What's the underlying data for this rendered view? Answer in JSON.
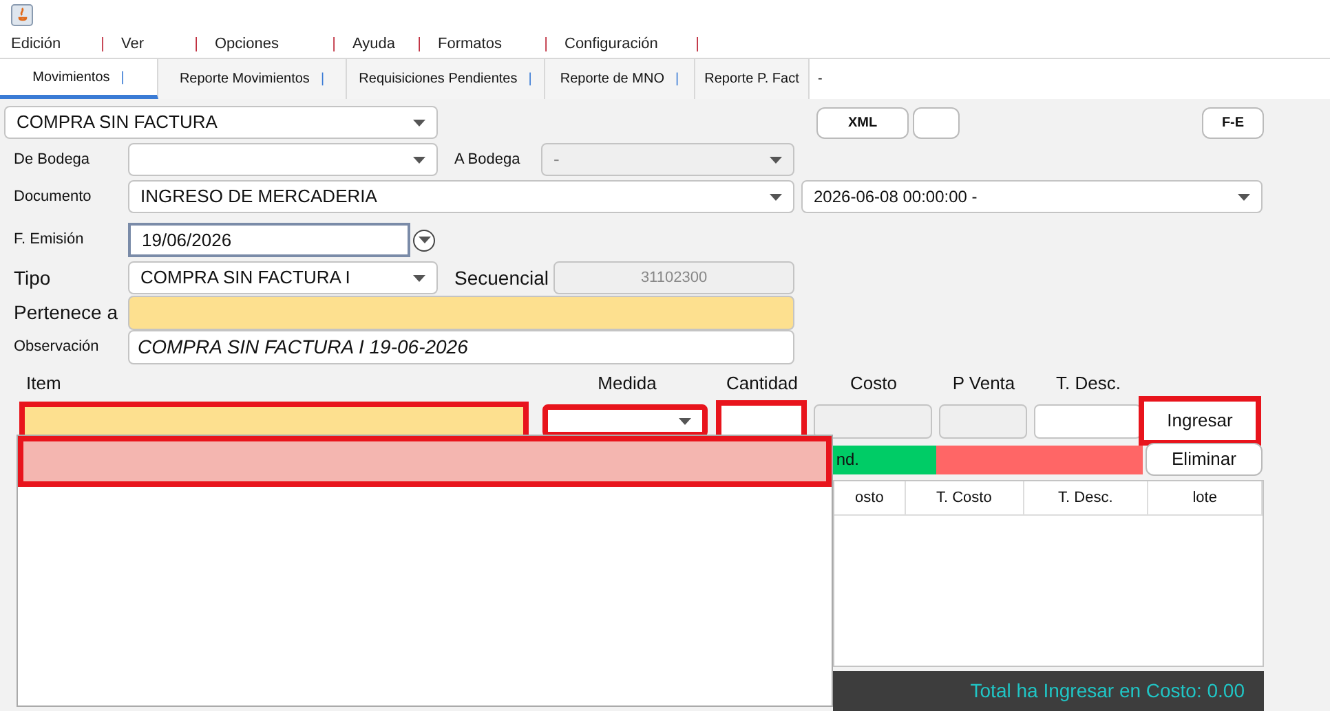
{
  "menu": [
    {
      "label": "Edición",
      "separator": "|"
    },
    {
      "label": "Ver",
      "separator": "|"
    },
    {
      "label": "Opciones",
      "separator": "|"
    },
    {
      "label": "Ayuda",
      "separator": "|"
    },
    {
      "label": "Formatos",
      "separator": "|"
    },
    {
      "label": "Configuración",
      "separator": "|"
    }
  ],
  "tabs": [
    {
      "label": "Movimientos",
      "selected": true,
      "separator": "|"
    },
    {
      "label": "Reporte Movimientos",
      "selected": false,
      "separator": "|"
    },
    {
      "label": "Requisiciones Pendientes",
      "selected": false,
      "separator": "|"
    },
    {
      "label": "Reporte de MNO",
      "selected": false,
      "separator": "|"
    },
    {
      "label": "Reporte P. Fact",
      "selected": false
    }
  ],
  "tabs_trailing": "-",
  "mode": {
    "value": "COMPRA SIN FACTURA"
  },
  "buttons": {
    "xml": "XML",
    "fe": "F-E",
    "ingresar": {
      "label": "Ingresar",
      "highlighted": true
    },
    "eliminar": "Eliminar"
  },
  "form": {
    "de_bodega": {
      "label": "De Bodega"
    },
    "a_bodega": {
      "label": "A Bodega",
      "value": "-",
      "disabled": true
    },
    "documento": {
      "label": "Documento",
      "value": "INGRESO DE MERCADERIA",
      "date_value": "2026-06-08 00:00:00 -"
    },
    "emision": {
      "label": "F. Emisión",
      "value": "19/06/2026"
    },
    "tipo": {
      "label": "Tipo",
      "value": "COMPRA SIN FACTURA I"
    },
    "secuencial": {
      "label": "Secuencial",
      "value": "31102300",
      "disabled": true
    },
    "pertenece": {
      "label": "Pertenece a"
    },
    "observacion": {
      "label": "Observación",
      "value": "COMPRA SIN FACTURA I 19-06-2026"
    }
  },
  "item_entry": {
    "columns": [
      {
        "label": "Item",
        "highlighted": true
      },
      {
        "label": "Medida",
        "highlighted": true
      },
      {
        "label": "Cantidad",
        "highlighted": true
      },
      {
        "label": "Costo",
        "highlighted": false
      },
      {
        "label": "P Venta",
        "highlighted": false
      },
      {
        "label": "T. Desc.",
        "highlighted": false
      }
    ]
  },
  "status_bars": [
    {
      "text": "nd.",
      "color": "#00cc66"
    },
    {
      "color": "#ff6666"
    }
  ],
  "table": {
    "columns": [
      "osto",
      "T. Costo",
      "T. Desc.",
      "lote"
    ]
  },
  "total": "Total ha Ingresar en Costo: 0.00",
  "suggestions": [
    {
      "selected": true,
      "highlighted": true
    }
  ]
}
